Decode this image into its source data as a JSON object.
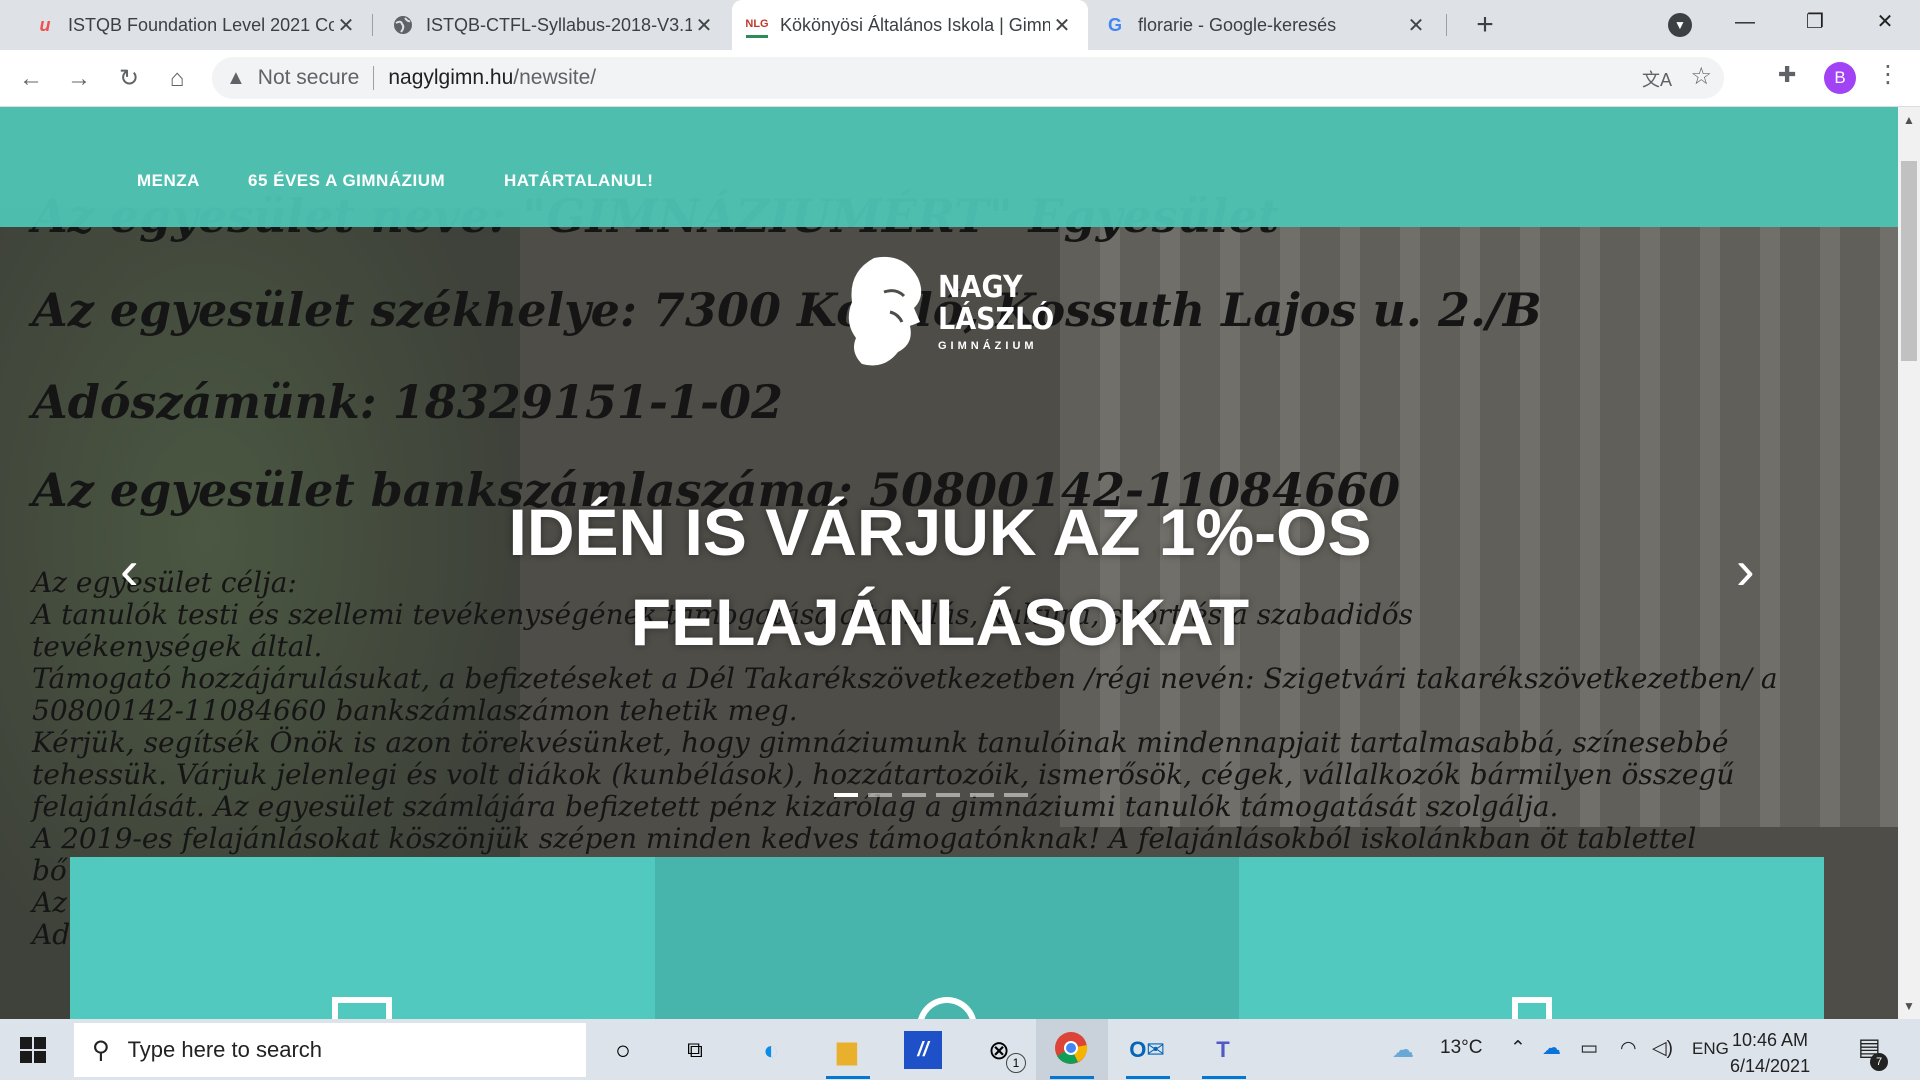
{
  "browser": {
    "tabs": [
      {
        "title": "ISTQB Foundation Level 2021 Co",
        "favicon": "u",
        "active": false
      },
      {
        "title": "ISTQB-CTFL-Syllabus-2018-V3.1-",
        "favicon": "globe",
        "active": false
      },
      {
        "title": "Kökönyösi Általános Iskola | Gimn",
        "favicon": "NLG",
        "active": true
      },
      {
        "title": "florarie - Google-keresés",
        "favicon": "G",
        "active": false
      }
    ],
    "close_glyph": "✕",
    "address": {
      "security_label": "Not secure",
      "host": "nagylgimn.hu",
      "path": "/newsite/"
    },
    "profile_initial": "B"
  },
  "page": {
    "nav_items": [
      "MENZA",
      "65 ÉVES A GIMNÁZIUM",
      "HATÁRTALANUL!"
    ],
    "logo": {
      "line1": "NAGY",
      "line2": "LÁSZLÓ",
      "line3": "GIMNÁZIUM"
    },
    "headline_line1": "IDÉN IS VÁRJUK AZ 1%-OS",
    "headline_line2": "FELAJÁNLÁSOKAT",
    "background_text": [
      "Az egyesület neve: \"GIMNÁZIUMÉRT\" Egyesület",
      "Az egyesület székhelye: 7300 Komló, Kossuth Lajos u. 2./B",
      "Adószámünk: 18329151-1-02",
      "Az egyesület bankszámlaszáma: 50800142-11084660",
      "Az egyesület célja:",
      "A tanulók testi és szellemi tevékenységének támogatása a tanulás, kultúra, sport és a szabadidős",
      "tevékenységek által.",
      "Támogató hozzájárulásukat, a befizetéseket a Dél Takarékszövetkezetben /régi nevén: Szigetvári takarékszövetkezetben/ a",
      "50800142-11084660 bankszámlaszámon tehetik meg.",
      "Kérjük, segítsék Önök is azon törekvésünket, hogy gimnáziumunk tanulóinak mindennapjait tartalmasabbá, színesebbé",
      "tehessük. Várjuk jelenlegi és volt diákok (kunbélások), hozzátartozóik, ismerősök, cégek, vállalkozók bármilyen összegű",
      "felajánlását. Az egyesület számlájára befizetett pénz kizárólag a gimnáziumi tanulók támogatását szolgálja.",
      "A 2019-es felajánlásokat köszönjük szépen minden kedves támogatónknak! A felajánlásokból iskolánkban öt tablettel",
      "bő",
      "Az",
      "Ad"
    ],
    "slider_dots": 6,
    "slider_active_dot": 0,
    "cards": [
      {
        "color": "#52c9bf"
      },
      {
        "color": "#47b5ab"
      },
      {
        "color": "#52c9bf"
      }
    ],
    "colors": {
      "nav": "#4ec9b9",
      "accent": "#52c9bf"
    }
  },
  "taskbar": {
    "search_placeholder": "Type here to search",
    "weather_temp": "13°C",
    "language": "ENG",
    "time": "10:46 AM",
    "date": "6/14/2021",
    "xbox_badge": "1",
    "notification_count": "7"
  }
}
